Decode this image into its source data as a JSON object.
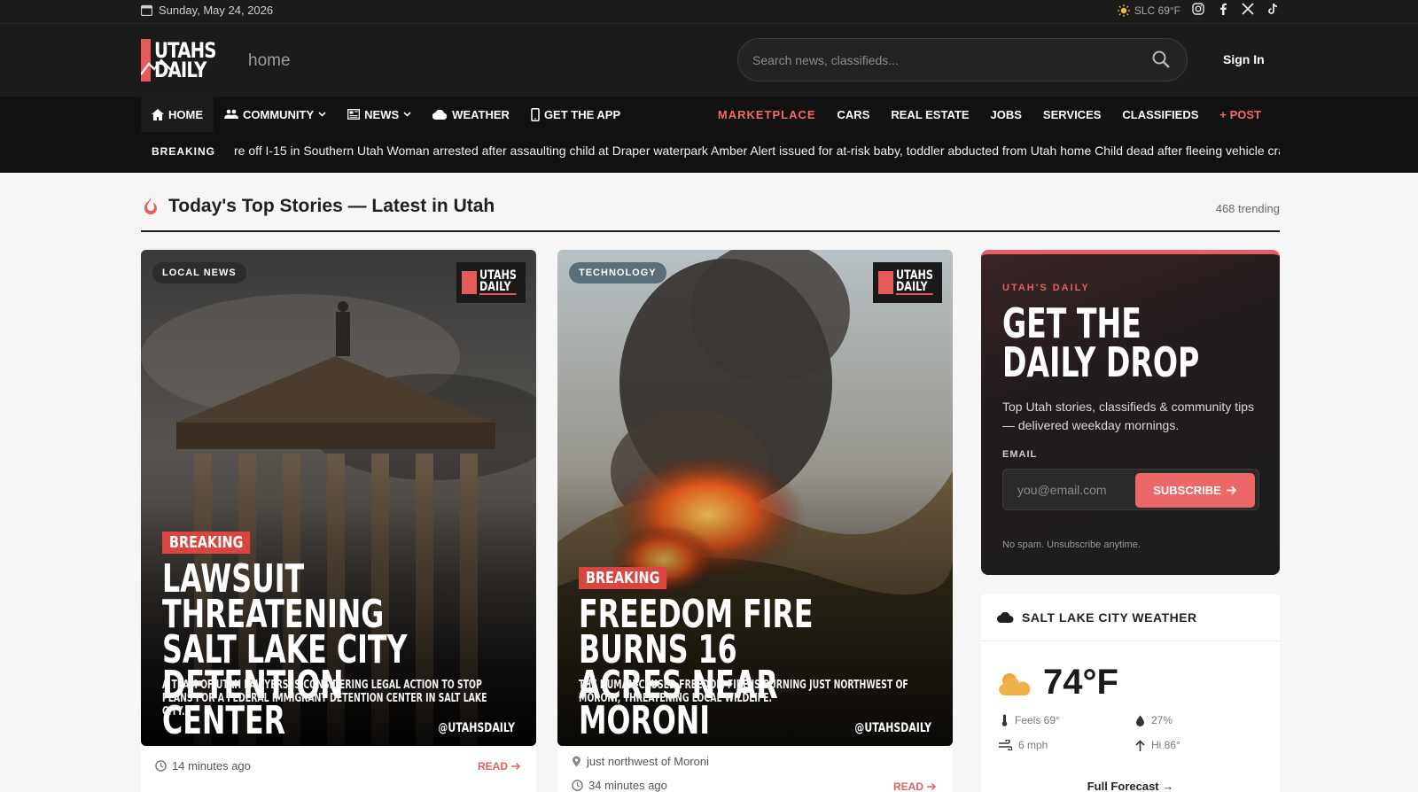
{
  "topbar": {
    "date": "Sunday, May 24, 2026",
    "weather": "SLC 69°F",
    "social": [
      "instagram-icon",
      "facebook-icon",
      "x-icon",
      "tiktok-icon"
    ]
  },
  "header": {
    "logo_line1": "UTAHS",
    "logo_line2": "DAILY",
    "page_label": "home",
    "search_placeholder": "Search news, classifieds...",
    "sign_in": "Sign In"
  },
  "nav": {
    "left": [
      {
        "label": "HOME",
        "icon": "house-icon"
      },
      {
        "label": "COMMUNITY",
        "icon": "people-icon",
        "dropdown": true
      },
      {
        "label": "NEWS",
        "icon": "newspaper-icon",
        "dropdown": true
      },
      {
        "label": "WEATHER",
        "icon": "cloud-icon"
      },
      {
        "label": "GET THE APP",
        "icon": "phone-icon"
      }
    ],
    "right": [
      "MARKETPLACE",
      "CARS",
      "REAL ESTATE",
      "JOBS",
      "SERVICES",
      "CLASSIFIEDS",
      "+ POST"
    ]
  },
  "ticker": {
    "label": "BREAKING",
    "text": "re off I-15 in Southern Utah   Woman arrested after assaulting child at Draper waterpark   Amber Alert issued for at-risk baby, toddler abducted from Utah home   Child dead after fleeing vehicle crashe"
  },
  "section": {
    "title": "Today's Top Stories — Latest in Utah",
    "trending": "468 trending"
  },
  "stories": [
    {
      "category": "LOCAL NEWS",
      "logo_line1": "UTAHS",
      "logo_line2": "DAILY",
      "tag": "BREAKING",
      "headline_1": "Lawsuit threatening",
      "headline_2": "Salt Lake City",
      "headline_3": "detention center",
      "dek": "A team of Utah lawyers is considering legal action to stop plans for a federal immigrant detention center in Salt Lake City.",
      "handle": "@UTAHSDAILY",
      "time": "14 minutes ago",
      "read": "READ"
    },
    {
      "category": "TECHNOLOGY",
      "logo_line1": "UTAHS",
      "logo_line2": "DAILY",
      "tag": "BREAKING",
      "headline_1": "Freedom Fire burns 16",
      "headline_2": "acres near Moroni",
      "dek": "The human-caused Freedom Fire is burning just northwest of Moroni, threatening local wildlife.",
      "handle": "@UTAHSDAILY",
      "location": "just northwest of Moroni",
      "time": "34 minutes ago",
      "read": "READ"
    }
  ],
  "newsletter": {
    "kicker": "UTAH'S DAILY",
    "title_1": "GET THE",
    "title_2": "DAILY DROP",
    "desc": "Top Utah stories, classifieds & community tips — delivered weekday mornings.",
    "email_label": "EMAIL",
    "email_placeholder": "you@email.com",
    "subscribe": "SUBSCRIBE",
    "nospam": "No spam. Unsubscribe anytime."
  },
  "weather": {
    "title": "SALT LAKE CITY WEATHER",
    "temp": "74°F",
    "feels": "Feels 69°",
    "humidity": "27%",
    "wind": "6 mph",
    "high": "Hi 86°",
    "forecast": "Full Forecast"
  },
  "colors": {
    "accent": "#e65f5f",
    "dark": "#1b1b1b",
    "breaking": "#d9463f"
  }
}
